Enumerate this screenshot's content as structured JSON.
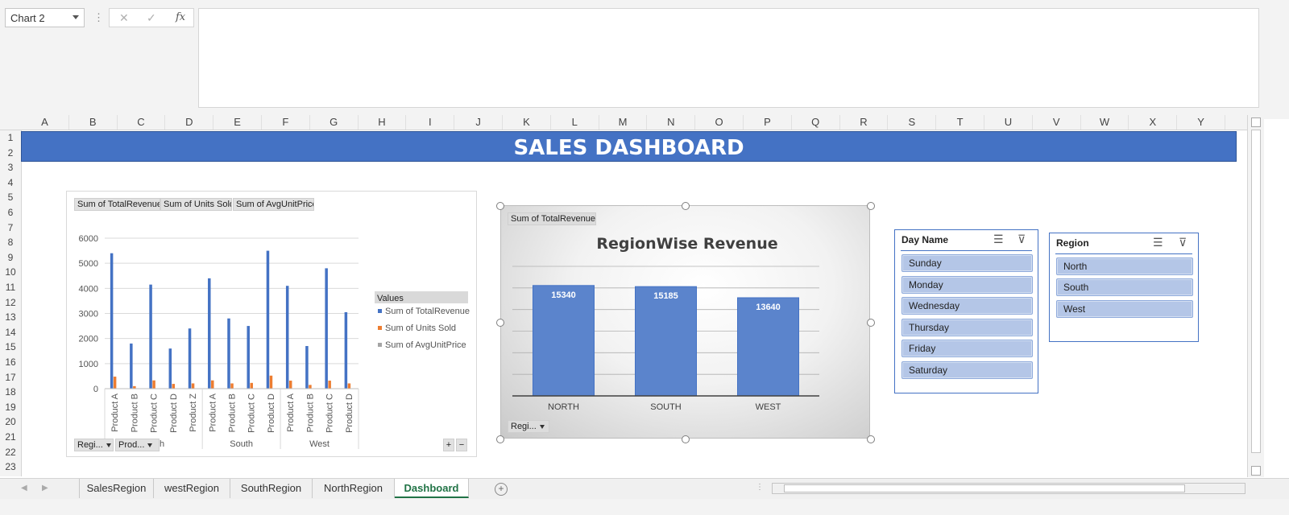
{
  "formula_bar": {
    "name_box": "Chart 2",
    "cancel_icon": "✕",
    "enter_icon": "✓",
    "fx_label": "fx",
    "formula": ""
  },
  "columns": [
    "A",
    "B",
    "C",
    "D",
    "E",
    "F",
    "G",
    "H",
    "I",
    "J",
    "K",
    "L",
    "M",
    "N",
    "O",
    "P",
    "Q",
    "R",
    "S",
    "T",
    "U",
    "V",
    "W",
    "X",
    "Y"
  ],
  "rows": [
    "1",
    "2",
    "3",
    "4",
    "5",
    "6",
    "7",
    "8",
    "9",
    "10",
    "11",
    "12",
    "13",
    "14",
    "15",
    "16",
    "17",
    "18",
    "19",
    "20",
    "21",
    "22",
    "23"
  ],
  "dashboard": {
    "title": "SALES DASHBOARD"
  },
  "pivot_chart_left": {
    "value_buttons": [
      "Sum of TotalRevenue",
      "Sum of Units Sold",
      "Sum of AvgUnitPrice"
    ],
    "legend_title": "Values",
    "axis_buttons": [
      "Regi...",
      "Prod..."
    ],
    "group_label_partial": "h",
    "plus": "+",
    "minus": "−"
  },
  "pivot_chart_right": {
    "value_button": "Sum of TotalRevenue",
    "axis_button": "Regi..."
  },
  "chart_data": [
    {
      "type": "bar",
      "ylim": [
        0,
        6000
      ],
      "yticks": [
        0,
        1000,
        2000,
        3000,
        4000,
        5000,
        6000
      ],
      "grid": true,
      "legend_position": "right",
      "groups": [
        {
          "name": "",
          "categories": [
            "Product A",
            "Product B",
            "Product C",
            "Product D",
            "Product Z"
          ]
        },
        {
          "name": "South",
          "categories": [
            "Product A",
            "Product B",
            "Product C",
            "Product D"
          ]
        },
        {
          "name": "West",
          "categories": [
            "Product A",
            "Product B",
            "Product C",
            "Product D"
          ]
        }
      ],
      "categories": [
        "Product A",
        "Product B",
        "Product C",
        "Product D",
        "Product Z",
        "Product A",
        "Product B",
        "Product C",
        "Product D",
        "Product A",
        "Product B",
        "Product C",
        "Product D"
      ],
      "series": [
        {
          "name": "Sum of TotalRevenue",
          "color": "#4472c4",
          "values": [
            5400,
            1800,
            4150,
            1600,
            2400,
            4400,
            2800,
            2500,
            5500,
            4100,
            1700,
            4800,
            3050
          ]
        },
        {
          "name": "Sum of Units Sold",
          "color": "#ed7d31",
          "values": [
            480,
            100,
            330,
            190,
            210,
            330,
            210,
            230,
            520,
            320,
            150,
            320,
            210
          ]
        },
        {
          "name": "Sum of AvgUnitPrice",
          "color": "#a5a5a5",
          "values": [
            11,
            18,
            13,
            8,
            11,
            13,
            13,
            11,
            11,
            13,
            11,
            15,
            15
          ]
        }
      ]
    },
    {
      "type": "bar",
      "title": "RegionWise Revenue",
      "categories": [
        "NORTH",
        "SOUTH",
        "WEST"
      ],
      "values": [
        15340,
        15185,
        13640
      ],
      "color": "#4472c4",
      "ylim": [
        0,
        18000
      ],
      "grid": true
    }
  ],
  "slicer_day": {
    "title": "Day Name",
    "items": [
      "Sunday",
      "Monday",
      "Wednesday",
      "Thursday",
      "Friday",
      "Saturday"
    ]
  },
  "slicer_region": {
    "title": "Region",
    "items": [
      "North",
      "South",
      "West"
    ]
  },
  "sheet_tabs": [
    "SalesRegion",
    "westRegion",
    "SouthRegion",
    "NorthRegion",
    "Dashboard"
  ],
  "active_tab": "Dashboard",
  "add_sheet_icon": "+"
}
